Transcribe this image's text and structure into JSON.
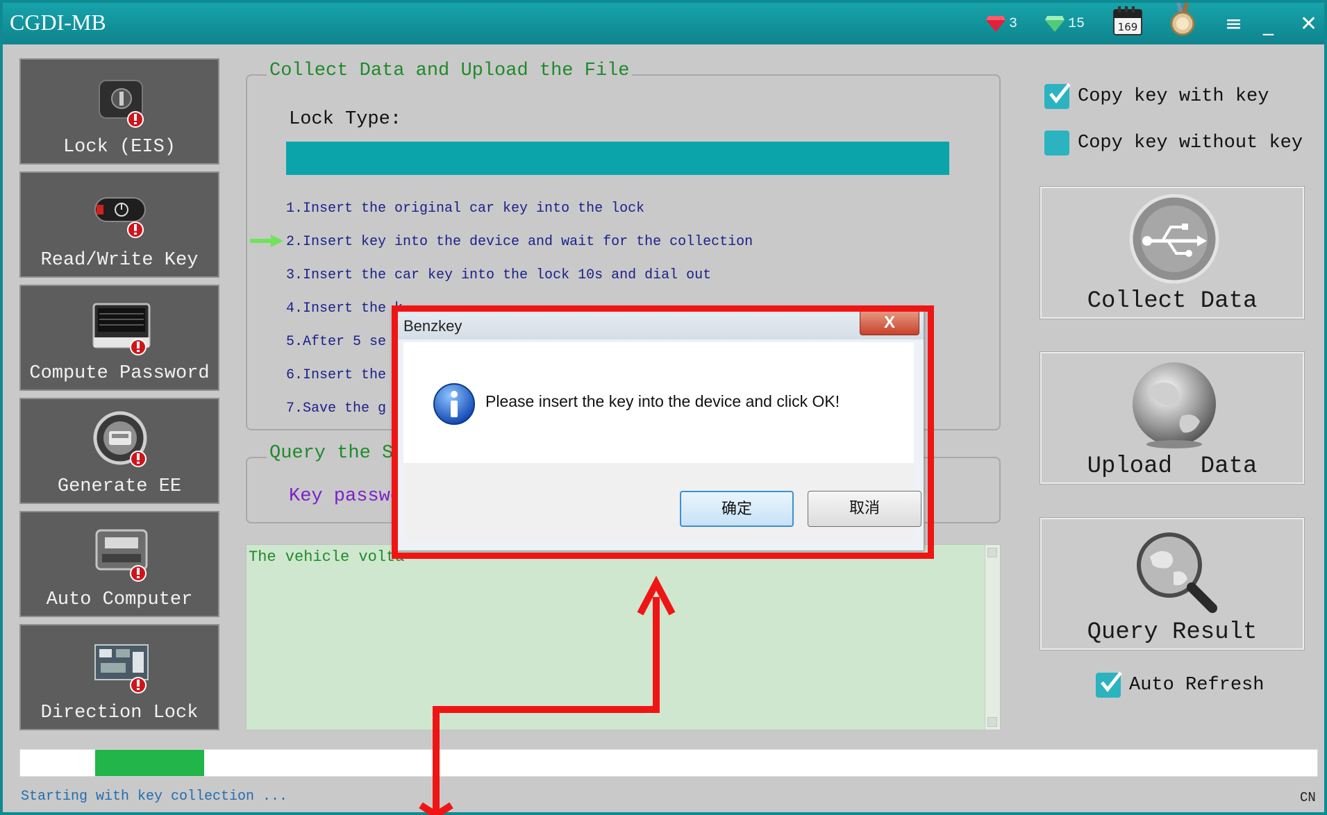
{
  "app": {
    "title": "CGDI-MB"
  },
  "titlebar": {
    "red_gem_count": "3",
    "green_gem_count": "15",
    "calendar_value": "169",
    "menu_glyph": "≡",
    "minimize_glyph": "_",
    "close_glyph": "✕"
  },
  "sidebar": {
    "items": [
      {
        "label": "Lock (EIS)",
        "icon": "lock-ignition-icon"
      },
      {
        "label": "Read/Write Key",
        "icon": "car-key-icon"
      },
      {
        "label": "Compute Password",
        "icon": "keyboard-icon"
      },
      {
        "label": "Generate EE",
        "icon": "generate-ee-icon"
      },
      {
        "label": "Auto Computer",
        "icon": "ecu-module-icon"
      },
      {
        "label": "Direction Lock",
        "icon": "circuit-board-icon"
      }
    ]
  },
  "collect_group": {
    "title": "Collect Data and Upload the File",
    "lock_type_label": "Lock Type:",
    "steps": [
      "1.Insert the original car key into the lock",
      "2.Insert key into the device and wait for the collection",
      "3.Insert the car key into the lock 10s and dial out",
      "4.Insert the k",
      "5.After 5 se",
      "6.Insert the",
      "7.Save the g"
    ],
    "active_step_index": 1
  },
  "query_group": {
    "title": "Query the S",
    "key_password_label": "Key passwo"
  },
  "log": {
    "text": "The vehicle volta"
  },
  "right_panel": {
    "copy_with_key": {
      "label": "Copy key with key",
      "checked": true
    },
    "copy_without_key": {
      "label": "Copy key without key",
      "checked": false
    },
    "collect_data": "Collect Data",
    "upload_data": "Upload  Data",
    "query_result": "Query Result",
    "auto_refresh": {
      "label": "Auto Refresh",
      "checked": true
    }
  },
  "progress": {
    "start_fraction": 0.058,
    "end_fraction": 0.142,
    "color": "#21b54a"
  },
  "status": {
    "text": "Starting with key collection ...",
    "language": "CN"
  },
  "dialog": {
    "title": "Benzkey",
    "close_label": "X",
    "message": "Please insert the key into the device and click OK!",
    "ok_label": "确定",
    "cancel_label": "取消",
    "icon": "info-icon"
  },
  "colors": {
    "titlebar": "#0f8a92",
    "lock_type_bar": "#0ba4ab",
    "group_title": "#1f8a2a",
    "step_text": "#1a1f8a",
    "annotation": "#f01515"
  }
}
